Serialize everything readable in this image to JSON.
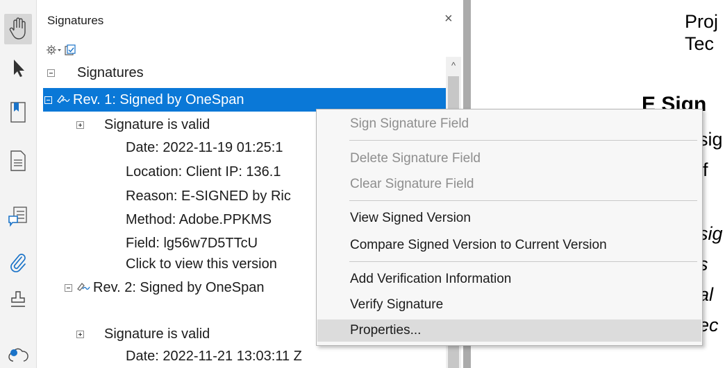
{
  "toolbar": {
    "tools": [
      {
        "name": "hand-tool",
        "icon": "hand-icon",
        "active": true
      },
      {
        "name": "select-tool",
        "icon": "arrow-pointer-icon"
      },
      {
        "name": "bookmarks-panel",
        "icon": "bookmark-icon"
      },
      {
        "name": "pages-panel",
        "icon": "page-icon"
      },
      {
        "name": "comments-panel",
        "icon": "comment-list-icon"
      },
      {
        "name": "attachments-panel",
        "icon": "paperclip-icon"
      },
      {
        "name": "signatures-panel",
        "icon": "stamp-icon"
      },
      {
        "name": "cloud-panel",
        "icon": "cloud-icon"
      }
    ]
  },
  "panel": {
    "title": "Signatures",
    "close_glyph": "×",
    "scroll_up_glyph": "^",
    "tree": [
      {
        "label": "Signatures",
        "toggle": "minus"
      },
      {
        "label": "Rev. 1: Signed by OneSpan",
        "toggle": "minus",
        "selected": true
      },
      {
        "label": "Signature is valid",
        "toggle": "plus"
      },
      {
        "label": "Date: 2022-11-19 01:25:1"
      },
      {
        "label": "Location: Client IP: 136.1"
      },
      {
        "label": "Reason: E-SIGNED by Ric"
      },
      {
        "label": "Method: Adobe.PPKMS"
      },
      {
        "label": "Field: lg56w7D5TTcU"
      },
      {
        "label": "Click to view this version"
      },
      {
        "label": "Rev. 2: Signed by OneSpan",
        "toggle": "minus"
      },
      {
        "label": "Signature is valid",
        "toggle": "plus"
      },
      {
        "label": "Date: 2022-11-21 13:03:11 Z"
      }
    ]
  },
  "document": {
    "lines": [
      "Proj",
      "Tec",
      "E Sign",
      "sig",
      "lf",
      "sig",
      "s",
      "al",
      "ec"
    ]
  },
  "context_menu": {
    "items": [
      {
        "label": "Sign Signature Field",
        "disabled": true
      },
      {
        "label": "Delete Signature Field",
        "disabled": true
      },
      {
        "label": "Clear Signature Field",
        "disabled": true
      },
      {
        "label": "View Signed Version"
      },
      {
        "label": "Compare Signed Version to Current Version"
      },
      {
        "label": "Add Verification Information"
      },
      {
        "label": "Verify Signature"
      },
      {
        "label": "Properties...",
        "highlighted": true
      }
    ]
  },
  "colors": {
    "selection": "#0a78d7",
    "icon_blue": "#1a73c8",
    "menu_background": "#f7f7f7",
    "menu_highlight": "#dcdcdc",
    "disabled_text": "#8e8e8e"
  }
}
